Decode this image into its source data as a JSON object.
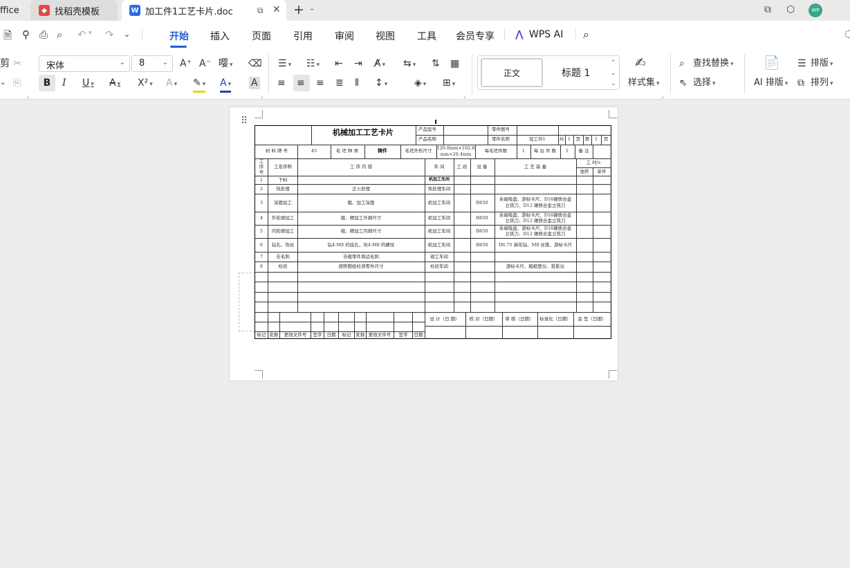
{
  "tabs": {
    "app_name": "ffice",
    "tab1": "找稻壳模板",
    "tab2": "加工件1工艺卡片.doc",
    "tab2_icon": "W"
  },
  "menu": {
    "items": [
      "开始",
      "插入",
      "页面",
      "引用",
      "审阅",
      "视图",
      "工具",
      "会员专享"
    ],
    "ai": "WPS AI"
  },
  "user": {
    "avatar": "WP"
  },
  "ribbon": {
    "font_name": "宋体",
    "font_size": "8",
    "style_normal": "正文",
    "style_heading": "标题 1",
    "style_set": "样式集",
    "find_replace": "查找替换",
    "select": "选择",
    "ai_layout": "AI 排版",
    "layout": "排版",
    "arrange": "排列"
  },
  "card": {
    "title": "机械加工工艺卡片",
    "product_model_label": "产品型号",
    "part_drawing_label": "零件图号",
    "product_name_label": "产品名称",
    "part_name_label": "零件名称",
    "part_name_value": "加工件1",
    "total_label": "共",
    "total_value": "1",
    "page_unit": "页",
    "nth_label": "第",
    "nth_value": "1",
    "page_unit2": "页",
    "material_label": "材 料 牌 号",
    "material_value": "45",
    "blank_type_label": "毛 坯 种 类",
    "blank_type_value": "铸件",
    "blank_size_label": "毛坯外形尺寸",
    "blank_size_value_1": "120.8mm×102.8",
    "blank_size_value_2": "mm×20.4mm",
    "per_blank_label": "每毛坯件数",
    "per_blank_value": "1",
    "per_unit_label": "每 台 件 数",
    "per_unit_value": "1",
    "remark_label": "备 注",
    "headers": {
      "seq_1": "工",
      "seq_2": "序",
      "seq_3": "号",
      "name": "工名序称",
      "content": "工        序        内        容",
      "workshop": "车 间",
      "section": "工 段",
      "equipment": "设 备",
      "tooling": "工   艺   装   备",
      "time": "工 时/s",
      "prep": "准终",
      "unit": "单件"
    },
    "rows": [
      {
        "no": "1",
        "name": "下料",
        "content": "",
        "shop": "机加工车间",
        "equip": "",
        "tool1": "",
        "tool2": ""
      },
      {
        "no": "2",
        "name": "热处理",
        "content": "正火处理",
        "shop": "热处理车间",
        "equip": "",
        "tool1": "",
        "tool2": ""
      },
      {
        "no": "3",
        "name": "深面加工",
        "content": "粗、加工深面",
        "shop": "机加工车间",
        "equip": "B850",
        "tool1": "永磁吸盘、游标卡尺、D16硬质合金",
        "tool2": "立铣刀、D12 硬质合金立铣刀"
      },
      {
        "no": "4",
        "name": "外轮廓加工",
        "content": "粗、精加工外廓尺寸",
        "shop": "机加工车间",
        "equip": "B850",
        "tool1": "永磁吸盘、游标卡尺、D16硬质合金",
        "tool2": "立铣刀、D12 硬质合金立铣刀"
      },
      {
        "no": "5",
        "name": "内轮廓加工",
        "content": "粗、精加工内廓尺寸",
        "shop": "机加工车间",
        "equip": "B850",
        "tool1": "永磁吸盘、游标卡尺、D16硬质合金",
        "tool2": "立铣刀、D12 硬质合金立铣刀"
      },
      {
        "no": "6",
        "name": "钻孔、攻丝",
        "content": "钻4-M8 的底孔，攻4-M8 的螺纹",
        "shop": "机加工车间",
        "equip": "B850",
        "tool1": "D6.75 麻花钻、M8 丝锥、游标卡尺",
        "tool2": ""
      },
      {
        "no": "7",
        "name": "去毛刺",
        "content": "去粗零件周边毛刺",
        "shop": "钳工车间",
        "equip": "",
        "tool1": "",
        "tool2": ""
      },
      {
        "no": "8",
        "name": "检验",
        "content": "按照图纸检测零件尺寸",
        "shop": "检验车间",
        "equip": "",
        "tool1": "游标卡尺、粗糙度仪、投影仪",
        "tool2": ""
      }
    ],
    "sign": {
      "design": "设 计（日 期）",
      "check": "校 对（日期）",
      "review": "审 核（日期）",
      "standard": "标准化（日期）",
      "countersign": "会 签（日期）"
    },
    "footer": [
      "标记",
      "处数",
      "更改文件号",
      "签字",
      "日期",
      "标记",
      "处数",
      "更改文件号",
      "签字",
      "日期"
    ]
  }
}
